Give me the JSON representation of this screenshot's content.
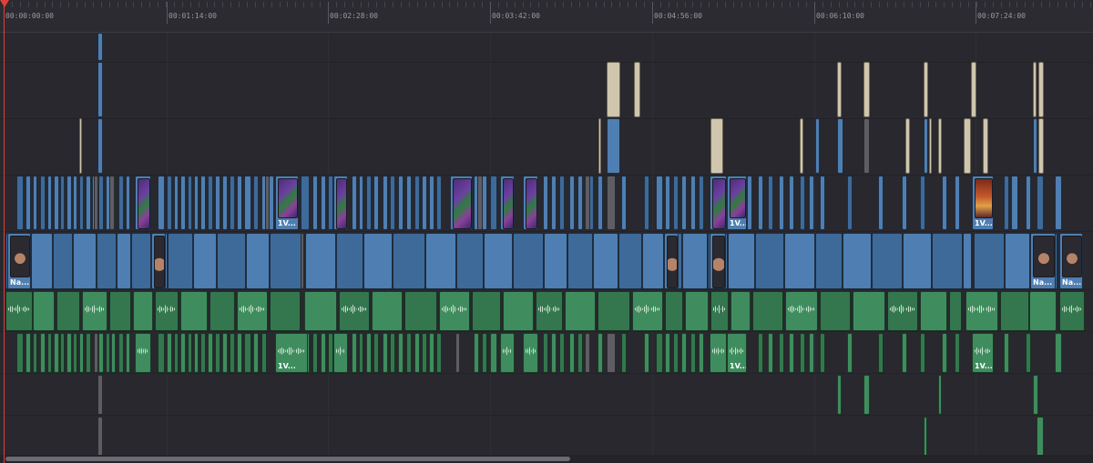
{
  "timeline": {
    "timecodes": [
      "00:00:00:00",
      "00:01:14:00",
      "00:02:28:00",
      "00:03:42:00",
      "00:04:56:00",
      "00:06:10:00",
      "00:07:24:00"
    ],
    "colors": {
      "video_clip": "#4f7fb2",
      "audio_clip": "#3f8d5e",
      "title_clip": "#cfc6ad",
      "disabled_clip": "#5d5d63",
      "playhead": "#e0403a"
    },
    "clip_labels": {
      "v2_clip": "1V...",
      "v1_clip": "Na..."
    },
    "icons": [
      "audio-waveform-icon",
      "video-thumbnail-icon"
    ]
  }
}
